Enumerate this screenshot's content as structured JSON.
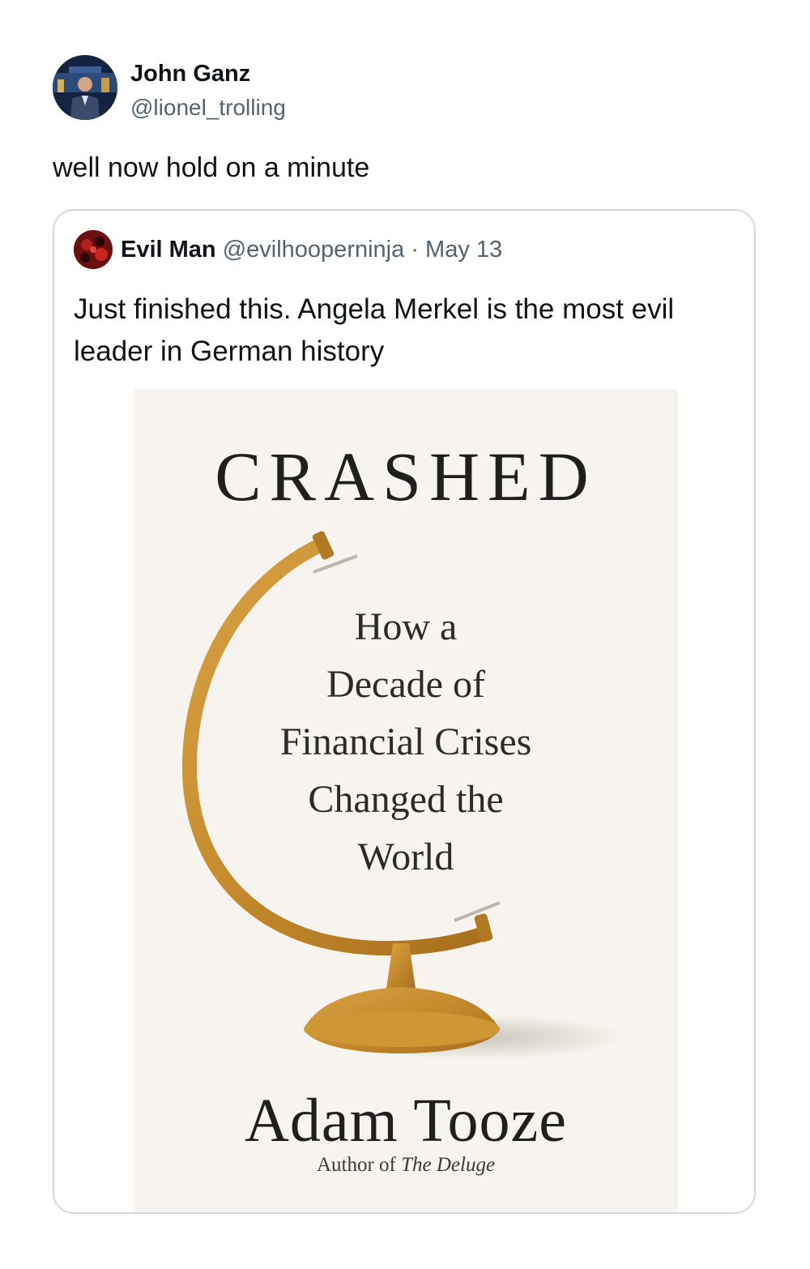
{
  "tweet": {
    "author": {
      "display_name": "John Ganz",
      "handle": "@lionel_trolling"
    },
    "text": "well now hold on a minute"
  },
  "quoted_tweet": {
    "author": {
      "display_name": "Evil Man",
      "handle": "@evilhooperninja"
    },
    "separator": "·",
    "date": "May 13",
    "text": "Just finished this. Angela Merkel is the most evil leader in German history",
    "media": {
      "title": "CRASHED",
      "subtitle_lines": [
        "How a",
        "Decade of",
        "Financial Crises",
        "Changed the",
        "World"
      ],
      "author": "Adam Tooze",
      "byline_prefix": "Author of ",
      "byline_book": "The Deluge"
    }
  },
  "colors": {
    "text_primary": "#0f1419",
    "text_secondary": "#536471",
    "border": "#cfd9de",
    "cover_background": "#f7f3ee",
    "globe_brass": "#c8902f"
  },
  "icons": {
    "avatar": "person-avatar-photo",
    "quoted_avatar": "red-black-avatar"
  }
}
